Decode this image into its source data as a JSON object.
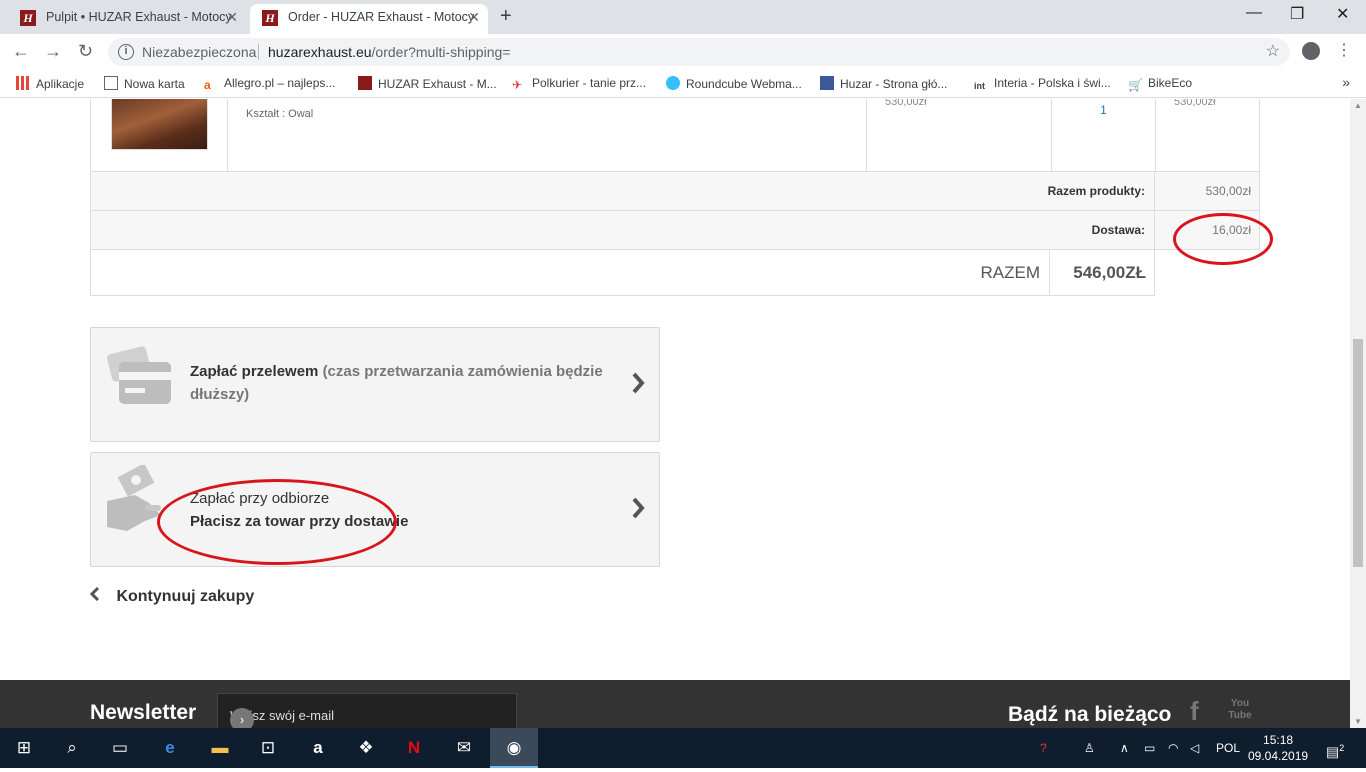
{
  "browser": {
    "tabs": [
      {
        "title": "Pulpit • HUZAR Exhaust - Motocy",
        "favicon": "H"
      },
      {
        "title": "Order - HUZAR Exhaust - Motocy",
        "favicon": "H"
      }
    ],
    "new_tab": "+",
    "window_controls": {
      "minimize": "—",
      "maximize": "❐",
      "close": "✕"
    },
    "security_label": "Niezabezpieczona",
    "url_host": "huzarexhaust.eu",
    "url_path": "/order?multi-shipping=",
    "bookmarks": [
      {
        "label": "Aplikacje",
        "icon": "apps-grid-icon"
      },
      {
        "label": "Nowa karta",
        "icon": "page-icon"
      },
      {
        "label": "Allegro.pl – najleps...",
        "icon": "allegro-icon"
      },
      {
        "label": "HUZAR Exhaust - M...",
        "icon": "huzar-icon"
      },
      {
        "label": "Polkurier - tanie prz...",
        "icon": "polkurier-icon"
      },
      {
        "label": "Roundcube Webma...",
        "icon": "roundcube-icon"
      },
      {
        "label": "Huzar - Strona głó...",
        "icon": "facebook-icon"
      },
      {
        "label": "Interia - Polska i świ...",
        "icon": "interia-icon"
      },
      {
        "label": "BikeEco",
        "icon": "cart-icon"
      }
    ],
    "bookmarks_more": "»"
  },
  "cart": {
    "product": {
      "attribute": "Kształt : Owal",
      "unit_price": "530,00zł",
      "quantity": "1",
      "line_total": "530,00zł"
    },
    "products_total_label": "Razem produkty:",
    "products_total_value": "530,00zł",
    "shipping_label": "Dostawa:",
    "shipping_value": "16,00zł",
    "grand_total_label": "RAZEM",
    "grand_total_value": "546,00ZŁ"
  },
  "payment_options": [
    {
      "title": "Zapłać przelewem",
      "note": "(czas przetwarzania zamówienia będzie dłuższy)",
      "icon": "credit-card-icon"
    },
    {
      "title": "Zapłać przy odbiorze",
      "subtitle": "Płacisz za towar przy dostawie",
      "icon": "cash-in-hand-icon"
    }
  ],
  "continue_label": "Kontynuuj zakupy",
  "footer": {
    "newsletter_title": "Newsletter",
    "newsletter_placeholder": "Wpisz swój e-mail",
    "follow_title": "Bądź na bieżąco",
    "social_facebook": "f",
    "social_youtube": "You Tube"
  },
  "taskbar": {
    "language": "POL",
    "time": "15:18",
    "date": "09.04.2019",
    "notifications": "2"
  },
  "colors": {
    "annotation": "#d8141c",
    "footer_bg": "#333333",
    "taskbar_bg": "#0f1e2e"
  }
}
